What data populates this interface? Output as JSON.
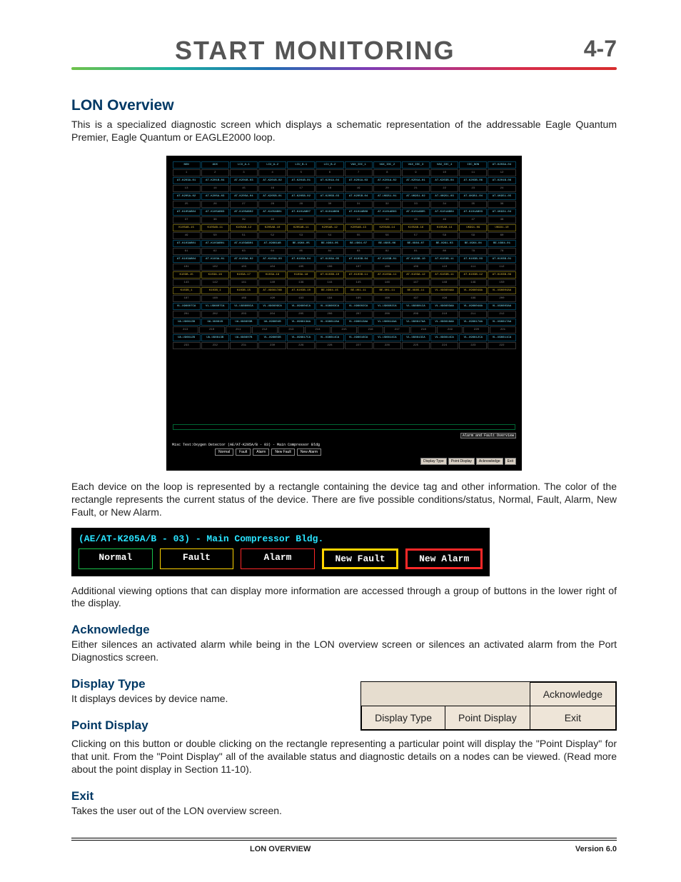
{
  "header": {
    "title": "START MONITORING",
    "page": "4-7"
  },
  "lon": {
    "heading": "LON Overview",
    "intro": "This is a specialized diagnostic screen which displays a schematic representation of the addressable Eagle Quantum Premier, Eagle Quantum or EAGLE2000 loop."
  },
  "diag": {
    "lowbar_prefix": "Misc Test:Oxygen Detector (AE/AT-K205A/B - 03) - Main Compressor Bldg",
    "row1_labels": [
      "NON",
      "AUX",
      "LCU_A-1",
      "LCU_A-2",
      "LCU_B-1",
      "LCU_B-2",
      "VAX_IDC_1",
      "VAX_IDC_2",
      "VAX_IDC_3",
      "VAX_IDC_4",
      "IDC_NON",
      "AT-K203A-04"
    ],
    "row1_nums": [
      "1",
      "2",
      "3",
      "4",
      "5",
      "6",
      "7",
      "8",
      "9",
      "10",
      "11",
      "12"
    ],
    "row2_labels": [
      "AT-K203A-01",
      "AT-K201B-04",
      "AT-K201B-03",
      "AT-K201B-02",
      "AT-K201B-01",
      "AT-K201A-04",
      "AT-K201A-03",
      "AT-K201A-02",
      "AT-K201A-01",
      "AT-K203B-04",
      "AT-K203B-06",
      "AT-K201B-06"
    ],
    "row2_nums": [
      "13",
      "14",
      "15",
      "16",
      "17",
      "18",
      "19",
      "20",
      "21",
      "22",
      "23",
      "24"
    ],
    "row3_labels": [
      "AT-K205A-02",
      "AT-K205A-03",
      "AT-K205A-04",
      "AT-K205B-01",
      "AT-K205B-02",
      "AT-K205B-03",
      "AT-K205B-04",
      "AT-UK951-01",
      "AT-UK951-02",
      "AT-UK951-03",
      "AT-UK951-04",
      "AT-UK951-05"
    ],
    "row3_nums": [
      "25",
      "26",
      "27",
      "28",
      "29",
      "30",
      "31",
      "32",
      "33",
      "34",
      "35",
      "36"
    ],
    "row4_labels": [
      "AT-K105AB04",
      "AT-K105AB03",
      "AT-K105AB02",
      "AT-K105AB01",
      "AT-K101AB07",
      "AT-K101AB08",
      "AT-K101AB08",
      "AT-K101AB03",
      "AT-K101AB05",
      "AT-K101AB04",
      "AT-K101AB03",
      "AT-UK931-04"
    ],
    "row4_nums": [
      "37",
      "38",
      "39",
      "40",
      "41",
      "42",
      "43",
      "44",
      "45",
      "46",
      "47",
      "48"
    ],
    "row5_labels": [
      "K105AB-15",
      "K105AB-11",
      "K105AB-12",
      "K205AB-10",
      "K205AB-11",
      "K205AB-12",
      "K205AB-13",
      "K205AB-14",
      "K105AB-16",
      "K105AB-14",
      "UK991-09",
      "UK991-10"
    ],
    "row5_nums": [
      "49",
      "50",
      "51",
      "52",
      "53",
      "54",
      "55",
      "56",
      "57",
      "58",
      "59",
      "60"
    ],
    "row6_labels": [
      "AT-K103AB01",
      "AT-K103AB01",
      "AT-K103AB01",
      "AT-U9661AB",
      "BE-U964-05",
      "BE-U964-05",
      "BE-U964-07",
      "BE-U965-06",
      "BE-U964-07",
      "BE-U961-03",
      "BE-U964-04",
      "BE-U964-01"
    ],
    "row6_nums": [
      "61",
      "62",
      "63",
      "64",
      "85",
      "84",
      "83",
      "82",
      "81",
      "80",
      "79",
      "78"
    ],
    "row7_labels": [
      "AT-K103AB04",
      "AT-K103A-01",
      "AT-K103A-02",
      "AT-K103A-03",
      "AT-K103A-04",
      "AT-K103A-05",
      "AT-K103B-04",
      "AT-K103B-01",
      "AT-K103B-10",
      "AT-K103B-11",
      "AT-K103B-03",
      "AT-K103B-01"
    ],
    "row7_nums": [
      "101",
      "102",
      "103",
      "104",
      "105",
      "106",
      "107",
      "108",
      "109",
      "110",
      "111",
      "112"
    ],
    "row8_labels": [
      "K103B-15",
      "K103A-16",
      "K103A-17",
      "K103A-19",
      "K103A-18",
      "AT-K103B-10",
      "AT-K103B-11",
      "AT-K103A-11",
      "AT-K103A-12",
      "AT-K103B-11",
      "AT-K103B-12",
      "AT-K103B-09"
    ],
    "row8_nums": [
      "143",
      "142",
      "141",
      "140",
      "139",
      "144",
      "145",
      "146",
      "147",
      "148",
      "149",
      "150"
    ],
    "row9_labels": [
      "K103B_1",
      "K103B_1",
      "K103B-15",
      "AT-U96617AB",
      "AT-K103B-10",
      "BE-U964-15",
      "BE-UK1-11",
      "BE-UK1-11",
      "BE-U965-11",
      "VL-U96604AA",
      "VL-U96604AA",
      "VL-U96604AA"
    ],
    "row9_nums": [
      "187",
      "188",
      "189",
      "190",
      "193",
      "194",
      "195",
      "196",
      "197",
      "198",
      "199",
      "200"
    ],
    "row10_labels": [
      "VL-U96607CA",
      "VL-U96607CA",
      "VL-U96608CA",
      "VL-U96609CA",
      "VL-U96604CA",
      "VL-U96603CA",
      "VL-U96602CA",
      "VL-U96602CA",
      "VL-U96601CA",
      "VL-U96603AA",
      "VL-U96604AA",
      "VL-U96603AA"
    ],
    "row10_nums": [
      "201",
      "202",
      "203",
      "204",
      "205",
      "206",
      "207",
      "208",
      "209",
      "210",
      "211",
      "212"
    ],
    "row11_labels": [
      "UA-U96613B",
      "UA-U9661B",
      "UA-U96603B",
      "UA-U96604B",
      "VL-U96613AA",
      "VL-U96612AA",
      "VL-U96613AA",
      "VL-U96614AA",
      "VL-U96617AA",
      "VL-U96616AA",
      "VL-U96617AA",
      "VL-U96617AA"
    ],
    "row11_nums": [
      "213",
      "210",
      "211",
      "212",
      "213",
      "214",
      "215",
      "216",
      "217",
      "218",
      "219",
      "220",
      "221"
    ],
    "row12_labels": [
      "UA-U96612B",
      "UA-U96613B",
      "UA-U96607B",
      "VL-U96603B",
      "VL-U96617CA",
      "VL-U96614CA",
      "VL-U96616CA",
      "VL-U96614CA",
      "VL-U96613CA",
      "VL-U96614CA",
      "VL-U96612CA",
      "VL-U96611CA"
    ],
    "row12_nums": [
      "233",
      "232",
      "231",
      "230",
      "229",
      "228",
      "227",
      "226",
      "225",
      "224",
      "223",
      "222"
    ],
    "ackfault_label": "Alarm and Fault Overview",
    "status": [
      "Normal",
      "Fault",
      "Alarm",
      "New Fault",
      "New Alarm"
    ],
    "btns": [
      "Display Type",
      "Point Display",
      "Acknowledge",
      "Exit"
    ]
  },
  "legend": {
    "head": "(AE/AT-K205A/B - 03) - Main Compressor Bldg.",
    "normal": "Normal",
    "fault": "Fault",
    "alarm": "Alarm",
    "nfault": "New Fault",
    "nalarm": "New Alarm"
  },
  "p_after_diag": "Each device on the loop is represented by a rectangle containing the device tag and other information.  The color of the rectangle represents the current status of the device.  There are five possible conditions/status, Normal, Fault, Alarm, New Fault, or New Alarm.",
  "p_after_legend": "Additional viewing options that can display more information are accessed through a group of buttons in the lower right of the display.",
  "ack": {
    "h": "Acknowledge",
    "p": "Either silences an activated alarm while being in the LON overview screen or silences an activated alarm from the Port Diagnostics screen."
  },
  "dtype": {
    "h": "Display Type",
    "p": "It displays devices by device name."
  },
  "pdisp": {
    "h": "Point Display",
    "p": "Clicking  on this button or double clicking on the rectangle representing a particular point will display the \"Point Display\" for that unit.  From the \"Point Display\" all of the available status and diagnostic details on a nodes can be viewed.  (Read more about the point display in Section 11-10)."
  },
  "exit": {
    "h": "Exit",
    "p": "Takes the user out of the LON overview screen."
  },
  "btnfig": {
    "ack": "Acknowledge",
    "dtype": "Display Type",
    "pdisp": "Point Display",
    "exit": "Exit"
  },
  "footer": {
    "left": "LON OVERVIEW",
    "right": "Version 6.0"
  }
}
